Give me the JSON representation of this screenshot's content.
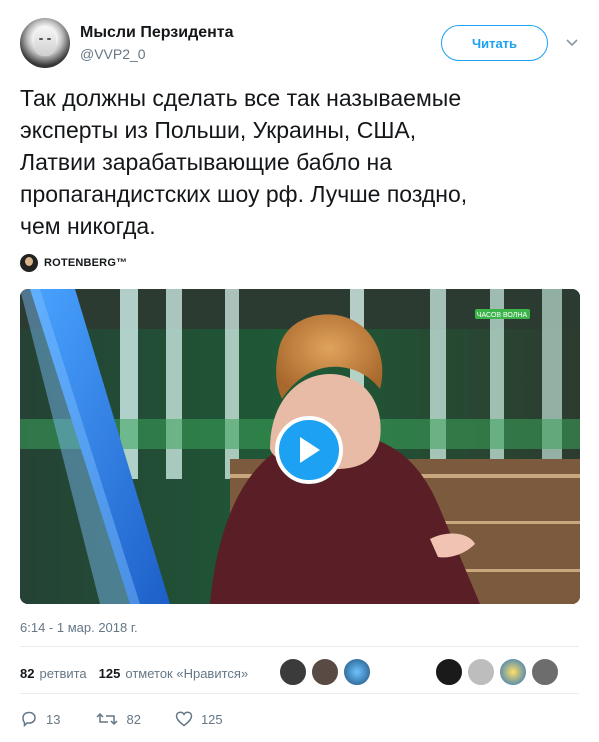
{
  "author": {
    "name": "Мысли Перзидента",
    "handle": "@VVP2_0"
  },
  "follow_label": "Читать",
  "tweet": {
    "text": "Так должны сделать все так называемые\nэксперты из Польши, Украины, США,\nЛатвии зарабатывающие бабло на\nпропагандистских шоу рф. Лучше поздно,\nчем никогда.",
    "via": "ROTENBERG™",
    "timestamp": "6:14 - 1 мар. 2018 г."
  },
  "media": {
    "type": "video",
    "play_icon": "play-icon",
    "channel_logo_text": "ЧАСОВ ВОЛНА"
  },
  "stats": {
    "retweets_count": "82",
    "retweets_label": "ретвита",
    "likes_count": "125",
    "likes_label": "отметок «Нравится»"
  },
  "likers": [
    {
      "icon": "liker-avatar-1",
      "color": "#3b3b3b"
    },
    {
      "icon": "liker-avatar-2",
      "color": "#5a4a44"
    },
    {
      "icon": "liker-avatar-3",
      "color": "#2c6fa3"
    },
    {
      "icon": "liker-avatar-4",
      "color": "#1a1a1a"
    },
    {
      "icon": "liker-avatar-5",
      "color": "#bdbdbd"
    },
    {
      "icon": "liker-avatar-6",
      "color": "#f2c200"
    },
    {
      "icon": "liker-avatar-7",
      "color": "#6d6d6d"
    }
  ],
  "actions": {
    "reply_count": "13",
    "retweet_count": "82",
    "like_count": "125"
  },
  "colors": {
    "accent": "#1da1f2",
    "muted": "#657786",
    "text": "#14171a",
    "divider": "#e6ecf0"
  }
}
